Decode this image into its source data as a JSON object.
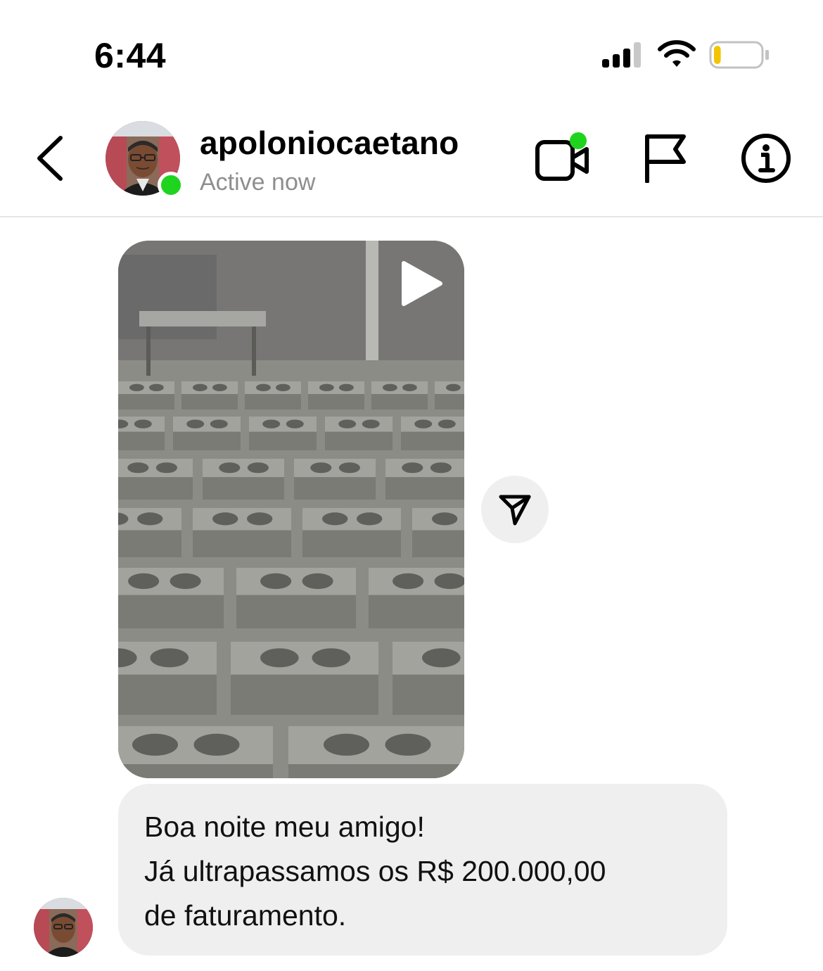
{
  "status_bar": {
    "time": "6:44",
    "signal_icon": "cellular-signal-icon",
    "wifi_icon": "wifi-icon",
    "battery_icon": "battery-icon",
    "battery_level": 0.15,
    "battery_color": "#f4c400"
  },
  "header": {
    "back_icon": "chevron-left-icon",
    "username": "apoloniocaetano",
    "status": "Active now",
    "online_color": "#1ed41e",
    "actions": [
      {
        "name": "video-call",
        "icon": "video-camera-icon"
      },
      {
        "name": "report",
        "icon": "flag-icon"
      },
      {
        "name": "info",
        "icon": "info-icon"
      }
    ]
  },
  "messages": [
    {
      "type": "video",
      "play_icon": "play-icon",
      "share_icon": "send-icon"
    },
    {
      "type": "text",
      "lines": [
        "Boa noite meu amigo!",
        "Já ultrapassamos os R$ 200.000,00",
        "de faturamento."
      ]
    }
  ]
}
